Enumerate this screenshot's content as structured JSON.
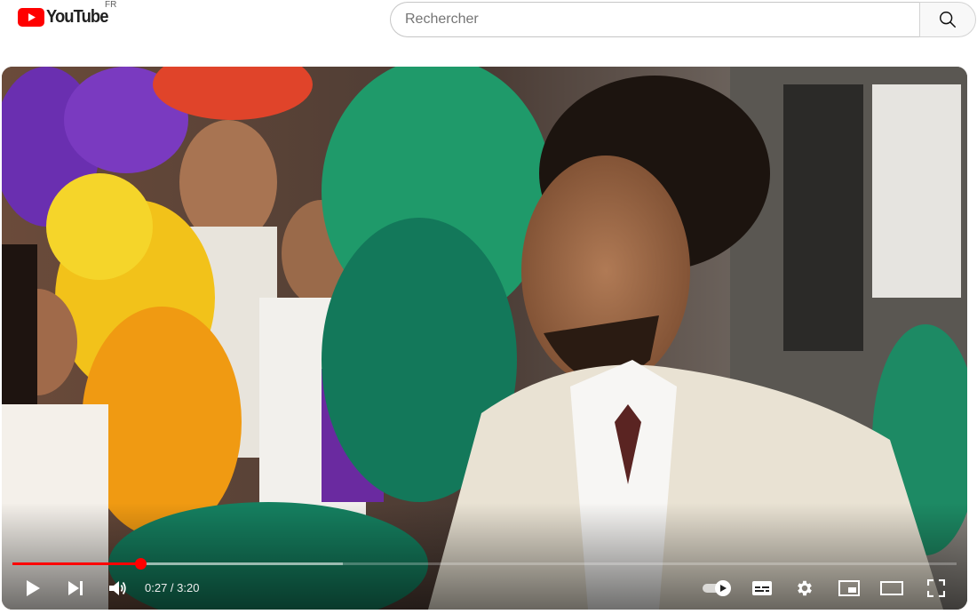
{
  "header": {
    "logo_text": "YouTube",
    "country_code": "FR",
    "brand_color": "#ff0000"
  },
  "search": {
    "placeholder": "Rechercher",
    "value": "",
    "icon": "search-icon"
  },
  "player": {
    "current_time": "0:27",
    "duration": "3:20",
    "time_display": "0:27 / 3:20",
    "progress_fraction": 0.135,
    "buffered_fraction": 0.35,
    "progress_color": "#ff0000",
    "autoplay_on": true,
    "controls": {
      "left": [
        "play-icon",
        "next-icon",
        "volume-icon"
      ],
      "right": [
        "autoplay-toggle",
        "subtitles-icon",
        "settings-icon",
        "miniplayer-icon",
        "theater-mode-icon",
        "fullscreen-icon"
      ]
    }
  }
}
